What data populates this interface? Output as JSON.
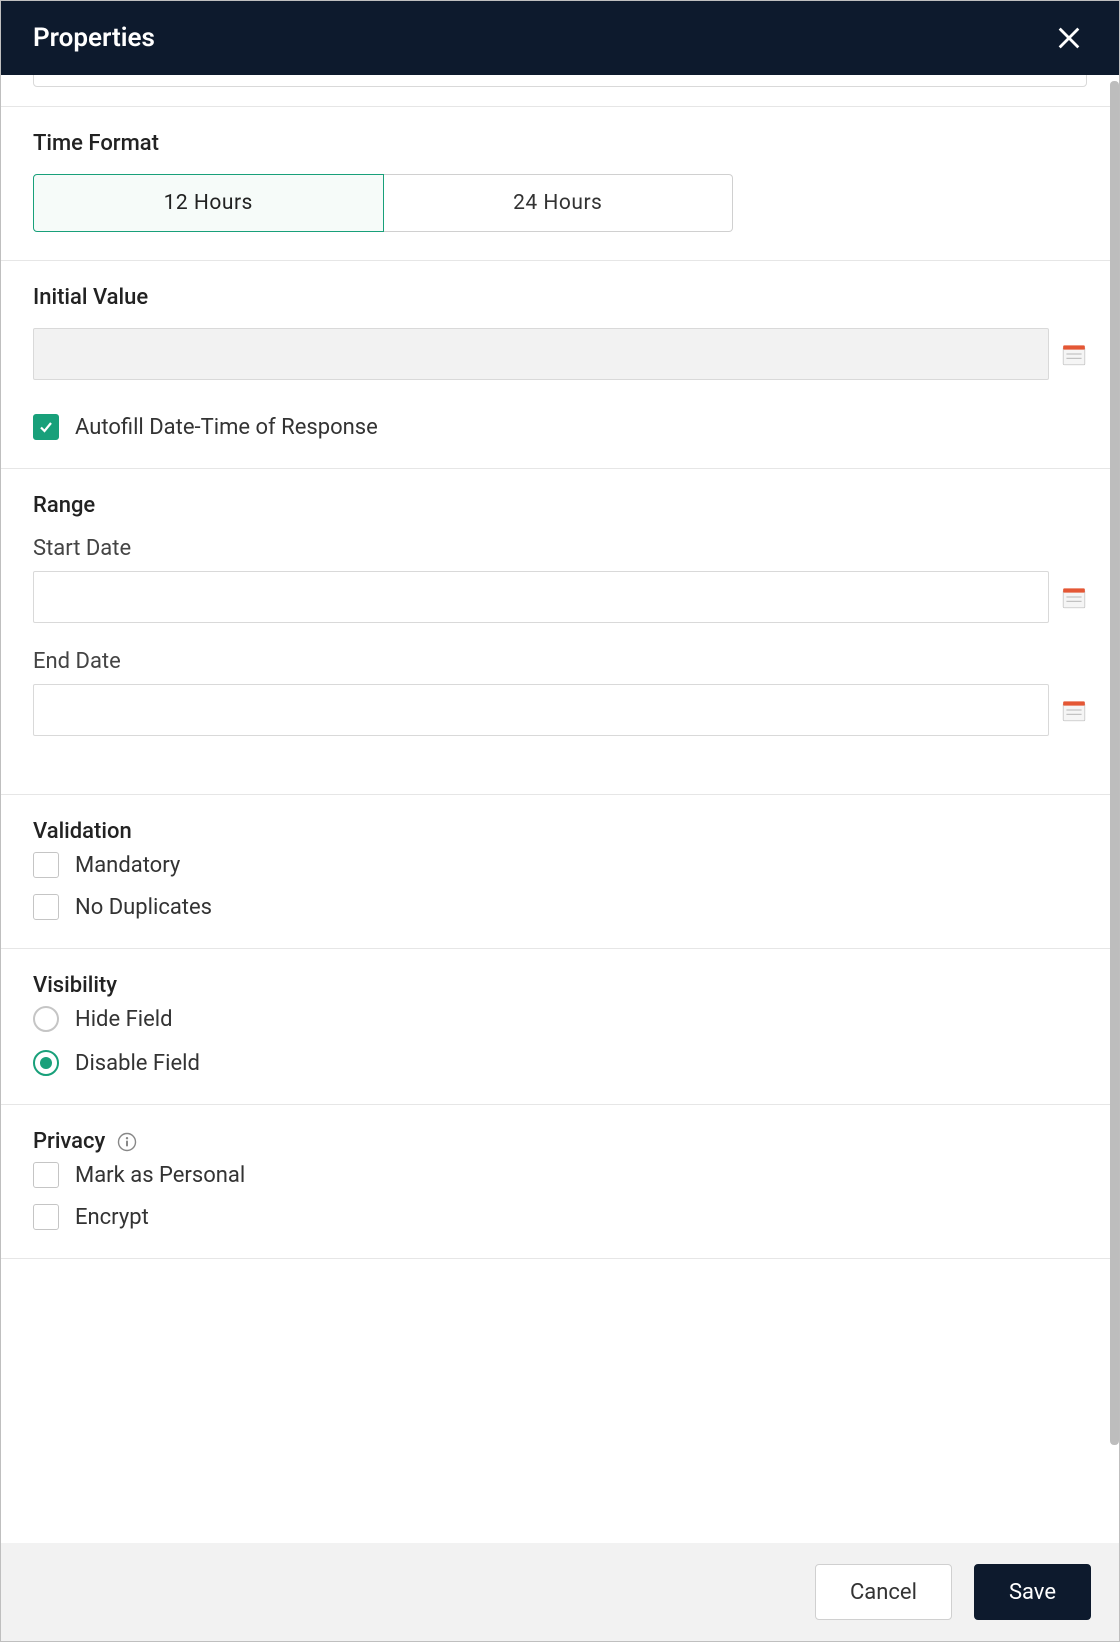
{
  "header": {
    "title": "Properties"
  },
  "timeFormat": {
    "heading": "Time Format",
    "options": [
      "12 Hours",
      "24 Hours"
    ],
    "selected": "12 Hours"
  },
  "initialValue": {
    "heading": "Initial Value",
    "value": "",
    "autofill": {
      "label": "Autofill Date-Time of Response",
      "checked": true
    }
  },
  "range": {
    "heading": "Range",
    "start": {
      "label": "Start Date",
      "value": ""
    },
    "end": {
      "label": "End Date",
      "value": ""
    }
  },
  "validation": {
    "heading": "Validation",
    "mandatory": {
      "label": "Mandatory",
      "checked": false
    },
    "noDuplicates": {
      "label": "No Duplicates",
      "checked": false
    }
  },
  "visibility": {
    "heading": "Visibility",
    "options": {
      "hide": "Hide Field",
      "disable": "Disable Field"
    },
    "selected": "disable"
  },
  "privacy": {
    "heading": "Privacy",
    "personal": {
      "label": "Mark as Personal",
      "checked": false
    },
    "encrypt": {
      "label": "Encrypt",
      "checked": false
    }
  },
  "footer": {
    "cancel": "Cancel",
    "save": "Save"
  }
}
